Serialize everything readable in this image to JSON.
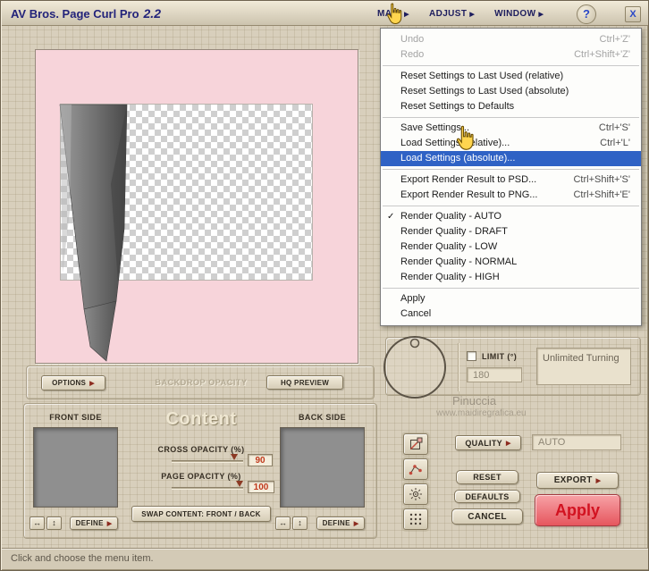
{
  "glyphs": {
    "menu_arrow": "▶",
    "check": "✓",
    "arrow_h": "↔",
    "arrow_v": "↕",
    "help": "?",
    "close": "X"
  },
  "colors": {
    "menu_highlight": "#2f62c5",
    "apply_text": "#d21220",
    "value_text": "#c0391c",
    "title_text": "#23237a"
  },
  "window": {
    "title": "AV Bros. Page Curl Pro",
    "version": "2.2"
  },
  "menubar": {
    "items": [
      {
        "label": "MAIN"
      },
      {
        "label": "ADJUST"
      },
      {
        "label": "WINDOW"
      }
    ]
  },
  "menu": {
    "items": [
      {
        "label": "Undo",
        "shortcut": "Ctrl+'Z'"
      },
      {
        "label": "Redo",
        "shortcut": "Ctrl+Shift+'Z'"
      },
      {
        "label": "Reset Settings to Last Used (relative)",
        "shortcut": ""
      },
      {
        "label": "Reset Settings to Last Used (absolute)",
        "shortcut": ""
      },
      {
        "label": "Reset Settings to Defaults",
        "shortcut": ""
      },
      {
        "label": "Save Settings...",
        "shortcut": "Ctrl+'S'"
      },
      {
        "label": "Load Settings (relative)...",
        "shortcut": "Ctrl+'L'"
      },
      {
        "label": "Load Settings (absolute)...",
        "shortcut": ""
      },
      {
        "label": "Export Render Result to PSD...",
        "shortcut": "Ctrl+Shift+'S'"
      },
      {
        "label": "Export Render Result to PNG...",
        "shortcut": "Ctrl+Shift+'E'"
      },
      {
        "label": "Render Quality - AUTO",
        "shortcut": ""
      },
      {
        "label": "Render Quality - DRAFT",
        "shortcut": ""
      },
      {
        "label": "Render Quality - LOW",
        "shortcut": ""
      },
      {
        "label": "Render Quality - NORMAL",
        "shortcut": ""
      },
      {
        "label": "Render Quality - HIGH",
        "shortcut": ""
      },
      {
        "label": "Apply",
        "shortcut": ""
      },
      {
        "label": "Cancel",
        "shortcut": ""
      }
    ]
  },
  "backdrop": {
    "options_label": "OPTIONS",
    "opacity_label": "BACKDROP OPACITY",
    "hq_preview_label": "HQ PREVIEW"
  },
  "content": {
    "title": "Content",
    "front_label": "FRONT SIDE",
    "back_label": "BACK SIDE",
    "cross_opacity_label": "CROSS OPACITY (%)",
    "cross_opacity_value": "90",
    "page_opacity_label": "PAGE OPACITY (%)",
    "page_opacity_value": "100",
    "swap_label": "SWAP CONTENT: FRONT / BACK",
    "define_label": "DEFINE"
  },
  "turning": {
    "limit_label": "LIMIT (°)",
    "limit_value": "180",
    "mode_text": "Unlimited Turning"
  },
  "watermark": {
    "name": "Pinuccia",
    "url": "www.maidiregrafica.eu"
  },
  "actions": {
    "quality_label": "QUALITY",
    "quality_value": "AUTO",
    "reset_label": "RESET",
    "defaults_label": "DEFAULTS",
    "cancel_label": "CANCEL",
    "export_label": "EXPORT",
    "apply_label": "Apply"
  },
  "status_bar": {
    "text": "Click and choose the menu item."
  }
}
